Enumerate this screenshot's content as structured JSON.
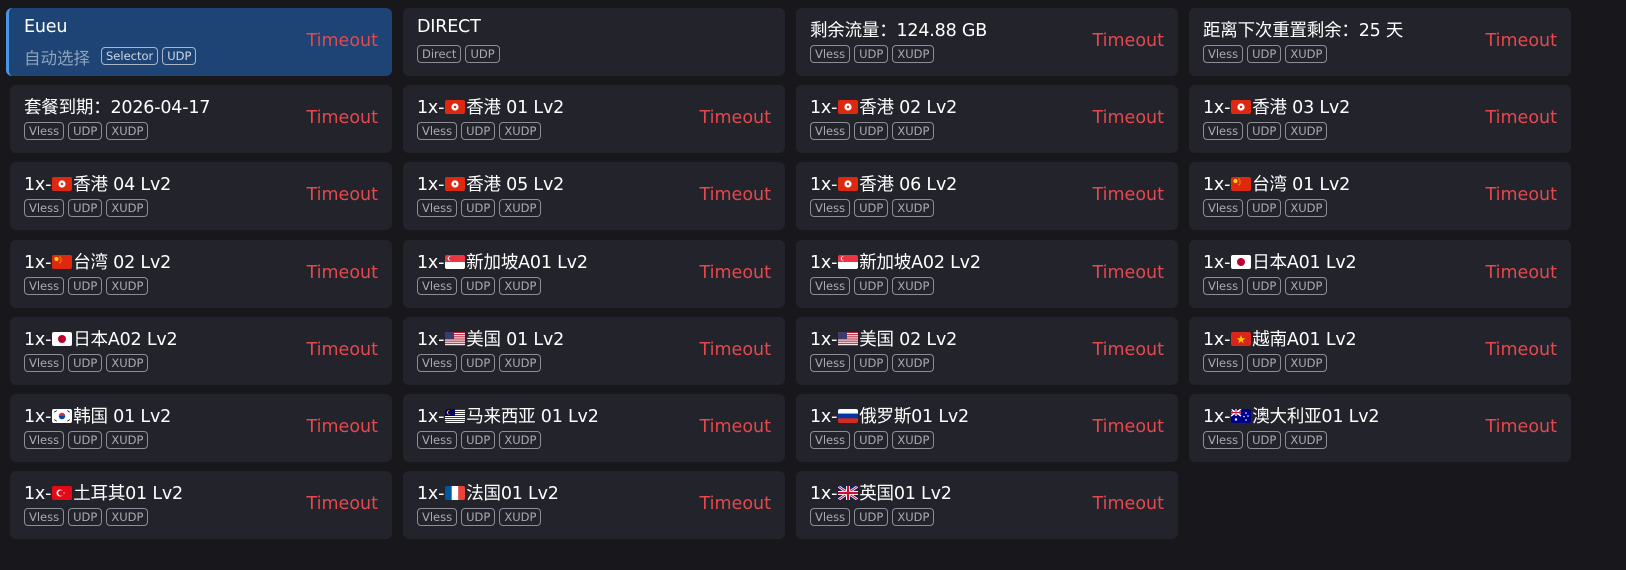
{
  "accent_color": "#e5484d",
  "selected_color": "#1d4474",
  "proxies": [
    {
      "name": "Eueu",
      "subtitle": "自动选择",
      "tags": [
        "Selector",
        "UDP"
      ],
      "status": "Timeout",
      "selected": true
    },
    {
      "name": "DIRECT",
      "tags": [
        "Direct",
        "UDP"
      ],
      "status": ""
    },
    {
      "name": "剩余流量：124.88 GB",
      "tags": [
        "Vless",
        "UDP",
        "XUDP"
      ],
      "status": "Timeout"
    },
    {
      "name": "距离下次重置剩余：25 天",
      "tags": [
        "Vless",
        "UDP",
        "XUDP"
      ],
      "status": "Timeout"
    },
    {
      "name": "套餐到期：2026-04-17",
      "tags": [
        "Vless",
        "UDP",
        "XUDP"
      ],
      "status": "Timeout"
    },
    {
      "prefix": "1x-",
      "flag": "hk",
      "name": "香港 01 Lv2",
      "tags": [
        "Vless",
        "UDP",
        "XUDP"
      ],
      "status": "Timeout"
    },
    {
      "prefix": "1x-",
      "flag": "hk",
      "name": "香港 02 Lv2",
      "tags": [
        "Vless",
        "UDP",
        "XUDP"
      ],
      "status": "Timeout"
    },
    {
      "prefix": "1x-",
      "flag": "hk",
      "name": "香港 03 Lv2",
      "tags": [
        "Vless",
        "UDP",
        "XUDP"
      ],
      "status": "Timeout"
    },
    {
      "prefix": "1x-",
      "flag": "hk",
      "name": "香港 04 Lv2",
      "tags": [
        "Vless",
        "UDP",
        "XUDP"
      ],
      "status": "Timeout"
    },
    {
      "prefix": "1x-",
      "flag": "hk",
      "name": "香港 05 Lv2",
      "tags": [
        "Vless",
        "UDP",
        "XUDP"
      ],
      "status": "Timeout"
    },
    {
      "prefix": "1x-",
      "flag": "hk",
      "name": "香港 06 Lv2",
      "tags": [
        "Vless",
        "UDP",
        "XUDP"
      ],
      "status": "Timeout"
    },
    {
      "prefix": "1x-",
      "flag": "cn",
      "name": "台湾 01 Lv2",
      "tags": [
        "Vless",
        "UDP",
        "XUDP"
      ],
      "status": "Timeout"
    },
    {
      "prefix": "1x-",
      "flag": "cn",
      "name": "台湾 02 Lv2",
      "tags": [
        "Vless",
        "UDP",
        "XUDP"
      ],
      "status": "Timeout"
    },
    {
      "prefix": "1x-",
      "flag": "sg",
      "name": "新加坡A01 Lv2",
      "tags": [
        "Vless",
        "UDP",
        "XUDP"
      ],
      "status": "Timeout"
    },
    {
      "prefix": "1x-",
      "flag": "sg",
      "name": "新加坡A02 Lv2",
      "tags": [
        "Vless",
        "UDP",
        "XUDP"
      ],
      "status": "Timeout"
    },
    {
      "prefix": "1x-",
      "flag": "jp",
      "name": "日本A01 Lv2",
      "tags": [
        "Vless",
        "UDP",
        "XUDP"
      ],
      "status": "Timeout"
    },
    {
      "prefix": "1x-",
      "flag": "jp",
      "name": "日本A02 Lv2",
      "tags": [
        "Vless",
        "UDP",
        "XUDP"
      ],
      "status": "Timeout"
    },
    {
      "prefix": "1x-",
      "flag": "us",
      "name": "美国 01 Lv2",
      "tags": [
        "Vless",
        "UDP",
        "XUDP"
      ],
      "status": "Timeout"
    },
    {
      "prefix": "1x-",
      "flag": "us",
      "name": "美国 02 Lv2",
      "tags": [
        "Vless",
        "UDP",
        "XUDP"
      ],
      "status": "Timeout"
    },
    {
      "prefix": "1x-",
      "flag": "vn",
      "name": "越南A01 Lv2",
      "tags": [
        "Vless",
        "UDP",
        "XUDP"
      ],
      "status": "Timeout"
    },
    {
      "prefix": "1x-",
      "flag": "kr",
      "name": "韩国 01 Lv2",
      "tags": [
        "Vless",
        "UDP",
        "XUDP"
      ],
      "status": "Timeout"
    },
    {
      "prefix": "1x-",
      "flag": "my",
      "name": "马来西亚 01 Lv2",
      "tags": [
        "Vless",
        "UDP",
        "XUDP"
      ],
      "status": "Timeout"
    },
    {
      "prefix": "1x-",
      "flag": "ru",
      "name": "俄罗斯01 Lv2",
      "tags": [
        "Vless",
        "UDP",
        "XUDP"
      ],
      "status": "Timeout"
    },
    {
      "prefix": "1x-",
      "flag": "au",
      "name": "澳大利亚01 Lv2",
      "tags": [
        "Vless",
        "UDP",
        "XUDP"
      ],
      "status": "Timeout"
    },
    {
      "prefix": "1x-",
      "flag": "tr",
      "name": "土耳其01 Lv2",
      "tags": [
        "Vless",
        "UDP",
        "XUDP"
      ],
      "status": "Timeout"
    },
    {
      "prefix": "1x-",
      "flag": "fr",
      "name": "法国01 Lv2",
      "tags": [
        "Vless",
        "UDP",
        "XUDP"
      ],
      "status": "Timeout"
    },
    {
      "prefix": "1x-",
      "flag": "gb",
      "name": "英国01 Lv2",
      "tags": [
        "Vless",
        "UDP",
        "XUDP"
      ],
      "status": "Timeout"
    }
  ]
}
